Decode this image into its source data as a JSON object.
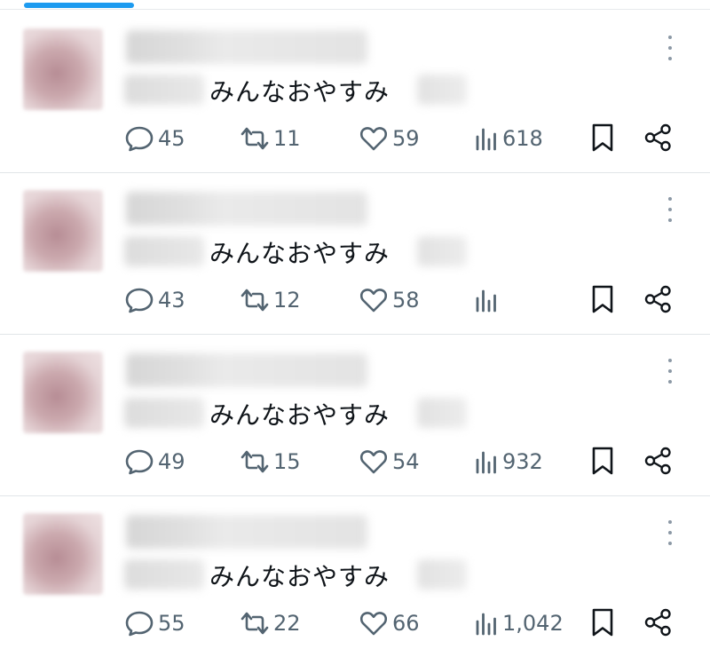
{
  "feed": {
    "tweets": [
      {
        "text": "みんなおやすみ",
        "replies": "45",
        "retweets": "11",
        "likes": "59",
        "views": "618"
      },
      {
        "text": "みんなおやすみ",
        "replies": "43",
        "retweets": "12",
        "likes": "58",
        "views": ""
      },
      {
        "text": "みんなおやすみ",
        "replies": "49",
        "retweets": "15",
        "likes": "54",
        "views": "932"
      },
      {
        "text": "みんなおやすみ",
        "replies": "55",
        "retweets": "22",
        "likes": "66",
        "views": "1,042"
      }
    ]
  },
  "colors": {
    "accent": "#1d9bf0",
    "icon": "#536471",
    "text": "#0f1419"
  },
  "icons": [
    "reply-icon",
    "retweet-icon",
    "like-icon",
    "views-icon",
    "bookmark-icon",
    "share-icon",
    "more-icon"
  ]
}
